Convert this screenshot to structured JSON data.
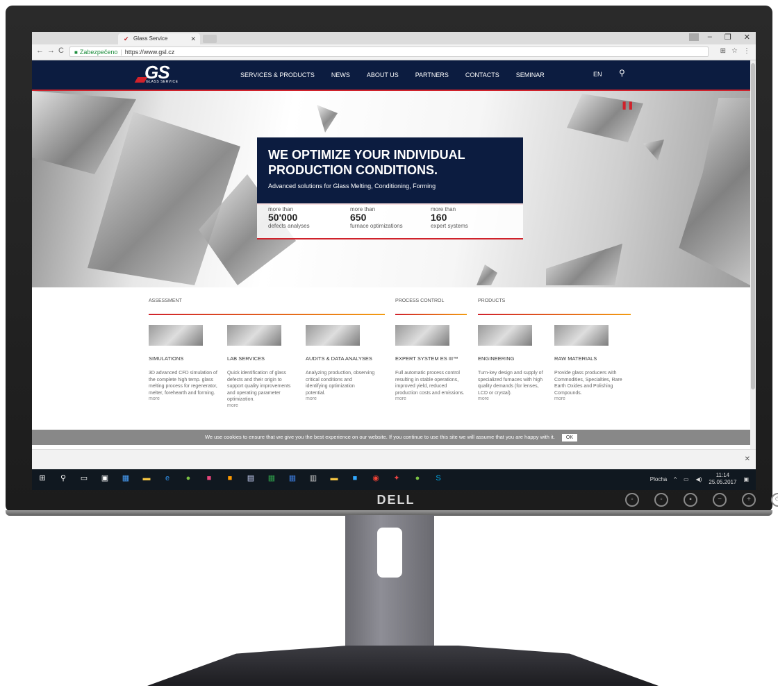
{
  "browser": {
    "tab_title": "Glass Service",
    "secure_label": "Zabezpečeno",
    "url": "https://www.gsl.cz"
  },
  "site": {
    "logo_text": "GS",
    "logo_sub": "GLASS SERVICE",
    "menu": [
      "SERVICES & PRODUCTS",
      "NEWS",
      "ABOUT US",
      "PARTNERS",
      "CONTACTS",
      "SEMINAR"
    ],
    "lang": "EN"
  },
  "hero": {
    "title": "WE OPTIMIZE YOUR INDIVIDUAL PRODUCTION CONDITIONS.",
    "subtitle": "Advanced solutions for Glass Melting, Conditioning, Forming",
    "stats": [
      {
        "pre": "more than",
        "num": "50'000",
        "label": "defects analyses"
      },
      {
        "pre": "more than",
        "num": "650",
        "label": "furnace optimizations"
      },
      {
        "pre": "more than",
        "num": "160",
        "label": "expert systems"
      }
    ]
  },
  "sections": {
    "groups": [
      "ASSESSMENT",
      "PROCESS CONTROL",
      "PRODUCTS"
    ],
    "cards": [
      {
        "title": "SIMULATIONS",
        "desc": "3D advanced CFD simulation of the complete high temp. glass melting process for regenerator, melter, forehearth and forming.",
        "more": "more"
      },
      {
        "title": "LAB SERVICES",
        "desc": "Quick identification of glass defects and their origin to support quality improvements and operating parameter optimization.",
        "more": "more"
      },
      {
        "title": "AUDITS & DATA ANALYSES",
        "desc": "Analyzing production, observing critical conditions and identifying optimization potential.",
        "more": "more"
      },
      {
        "title": "EXPERT SYSTEM ES III™",
        "desc": "Full automatic process control resulting in stable operations, improved yield, reduced production costs and emissions.",
        "more": "more"
      },
      {
        "title": "ENGINEERING",
        "desc": "Turn-key design and supply of specialized furnaces with high quality demands (for lenses, LCD or crystal).",
        "more": "more"
      },
      {
        "title": "RAW MATERIALS",
        "desc": "Provide glass producers with Commodities, Specialties, Rare Earth Oxides and Polishing Compounds.",
        "more": "more"
      }
    ]
  },
  "cookie": {
    "text": "We use cookies to ensure that we give you the best experience on our website. If you continue to use this site we will assume that you are happy with it.",
    "ok": "OK"
  },
  "taskbar": {
    "desktop_label": "Plocha",
    "time": "11:14",
    "date": "25.05.2017"
  },
  "monitor": {
    "brand": "DELL"
  }
}
